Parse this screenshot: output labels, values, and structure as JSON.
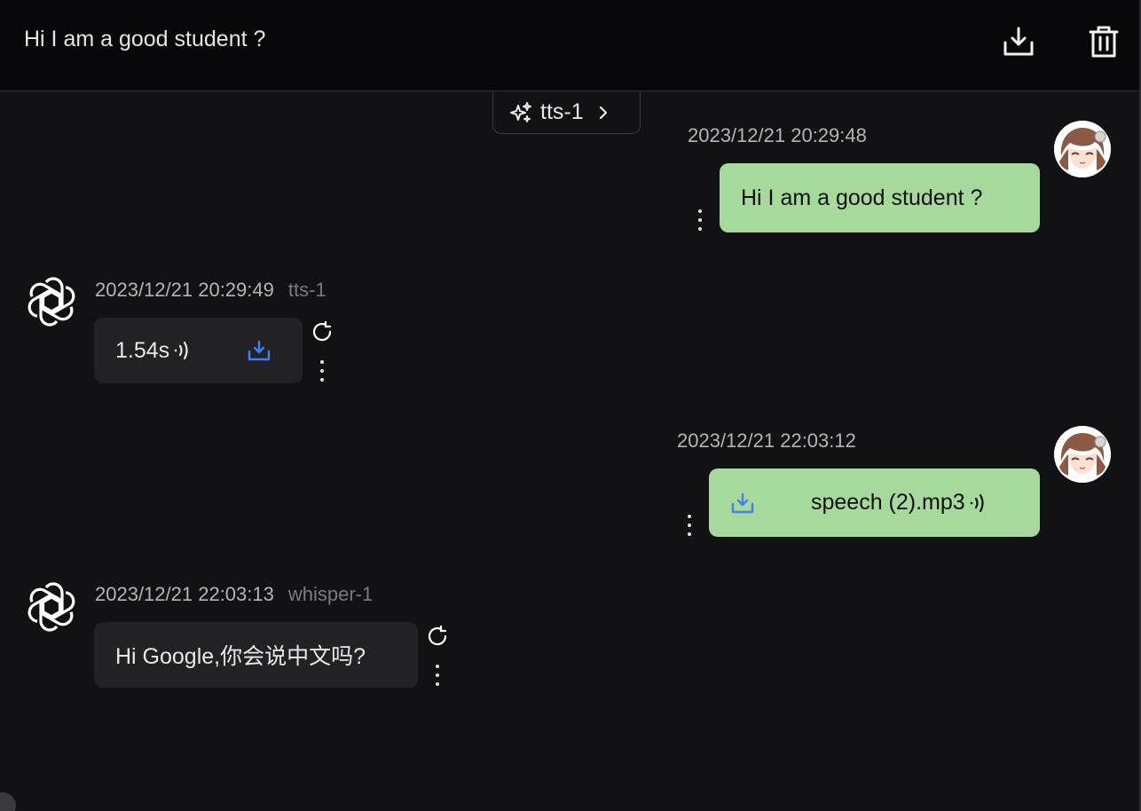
{
  "header": {
    "title": "Hi I am a good student ?"
  },
  "model_chip": {
    "label": "tts-1"
  },
  "messages": [
    {
      "role": "user",
      "timestamp": "2023/12/21 20:29:48",
      "text": "Hi I am a good student ?"
    },
    {
      "role": "assistant",
      "timestamp": "2023/12/21 20:29:49",
      "model": "tts-1",
      "audio_duration": "1.54s"
    },
    {
      "role": "user",
      "timestamp": "2023/12/21 22:03:12",
      "file_name": "speech (2).mp3"
    },
    {
      "role": "assistant",
      "timestamp": "2023/12/21 22:03:13",
      "model": "whisper-1",
      "text": "Hi Google,你会说中文吗?"
    }
  ],
  "colors": {
    "user_bubble": "#a7d89c",
    "bot_bubble": "#222226",
    "accent_download": "#3b82f6"
  }
}
